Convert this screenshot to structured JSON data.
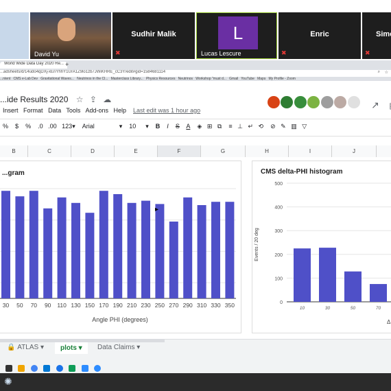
{
  "video": {
    "tiles": [
      {
        "name": "David Yu"
      },
      {
        "name": "Sudhir Malik"
      },
      {
        "name": "Lucas Lescure",
        "initial": "L"
      },
      {
        "name": "Enric"
      },
      {
        "name": "Simo"
      }
    ]
  },
  "browser": {
    "tab_title": "World Wide Data Day 2020 Re...",
    "url": "...adsheets/d/14udo4qDXj-xEnYhhY1UrA1Z9lo1zb7JWiKHRE_cC3Y/edit#gid=1584681114",
    "bookmarks": [
      "...ntent",
      "CMS e-Lab Dev",
      "Gravitational Waves...",
      "Neutrinos in the Cl...",
      "Masterclass Library...",
      "Physics Resources",
      "Neutrinos",
      "Workshop \"must d...",
      "Gmail",
      "YouTube",
      "Maps",
      "My Profile - Zoom"
    ]
  },
  "sheet": {
    "title": "...ide Results 2020",
    "menus": [
      "Insert",
      "Format",
      "Data",
      "Tools",
      "Add-ons",
      "Help"
    ],
    "last_edit": "Last edit was 1 hour ago",
    "toolbar": {
      "currency": "$",
      "percent": "%",
      "dec_less": ".0",
      "dec_more": ".00",
      "format": "123",
      "font": "Arial",
      "size": "10",
      "bold": "B",
      "italic": "I",
      "strike": "S",
      "text_color": "A"
    },
    "columns": [
      "B",
      "C",
      "D",
      "E",
      "F",
      "G",
      "H",
      "I",
      "J"
    ]
  },
  "chart_left": {
    "title": "...gram",
    "xlabel": "Angle PHI (degrees)",
    "color": "#4f50c8"
  },
  "chart_right": {
    "title": "CMS delta-PHI histogram",
    "ylabel": "Events / 20 deg",
    "xlabel_fragment": "Δ",
    "color": "#4f50c8"
  },
  "chart_data": [
    {
      "type": "bar",
      "title": "",
      "xlabel": "Angle PHI (degrees)",
      "ylabel": "",
      "categories": [
        "30",
        "50",
        "70",
        "90",
        "110",
        "130",
        "150",
        "170",
        "190",
        "210",
        "230",
        "250",
        "270",
        "290",
        "310",
        "330",
        "350"
      ],
      "values": [
        0.98,
        0.93,
        0.98,
        0.82,
        0.92,
        0.87,
        0.78,
        0.98,
        0.95,
        0.87,
        0.89,
        0.86,
        0.7,
        0.92,
        0.85,
        0.88,
        0.88
      ]
    },
    {
      "type": "bar",
      "title": "CMS delta-PHI histogram",
      "xlabel": "",
      "ylabel": "Events / 20 deg",
      "ylim": [
        0,
        500
      ],
      "yticks": [
        0,
        100,
        200,
        300,
        400,
        500
      ],
      "categories": [
        "10",
        "30",
        "50",
        "70"
      ],
      "values": [
        225,
        228,
        128,
        75
      ]
    }
  ],
  "tabs": {
    "items": [
      "ATLAS",
      "plots",
      "Data Claims"
    ],
    "active": "plots"
  }
}
